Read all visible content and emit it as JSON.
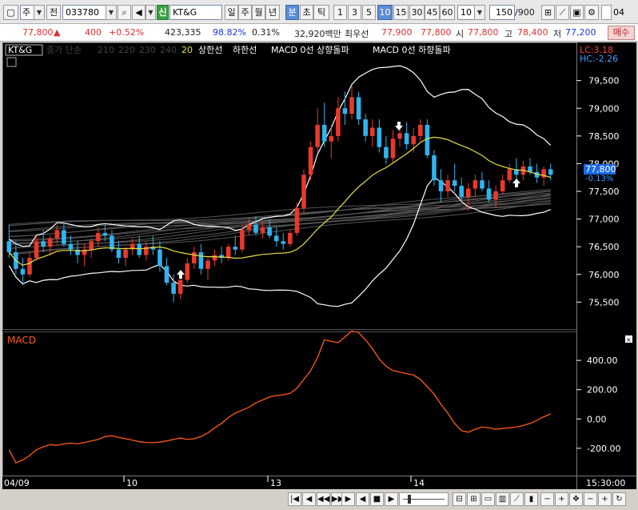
{
  "toolbar": {
    "market": "주",
    "prev_label": "전",
    "code": "033780",
    "badge": "신",
    "name": "KT&G",
    "periods": [
      "일",
      "주",
      "월",
      "년",
      "분",
      "초",
      "틱"
    ],
    "active_period": "분",
    "intervals": [
      "1",
      "3",
      "5",
      "10",
      "15",
      "30",
      "45",
      "60"
    ],
    "active_interval": "10",
    "interval_value": "10",
    "count": "150",
    "count_total": "/900",
    "date_check": "04"
  },
  "quote": {
    "price": "77,800",
    "price_arrow": "▲",
    "change": "400",
    "change_pct": "+0.52%",
    "volume": "423,335",
    "volume_ratio": "98.82%",
    "turnover_ratio": "0.31%",
    "amount": "32,920백만",
    "best_ask_label": "최우선",
    "best_ask": "77,900",
    "best_bid": "77,800",
    "open_label": "시",
    "open": "77,800",
    "high_label": "고",
    "high": "78,400",
    "low_label": "저",
    "low": "77,200",
    "buy_label": "매수"
  },
  "legend": {
    "stock": "KT&G",
    "ma_label": "종가 단순",
    "ma_periods": [
      "210",
      "220",
      "230",
      "240"
    ],
    "ma_20": "20",
    "upper_env": "상한선",
    "lower_env": "하한선",
    "macd_up": "MACD 0선 상향돌파",
    "macd_down": "MACD 0선 하향돌파",
    "lc": "LC:3.18",
    "hc": "HC:-2.26",
    "price_tag": "77,800",
    "pct_tag": "-0.13%"
  },
  "macd_panel": {
    "title": "MACD"
  },
  "x_labels": [
    "04/09",
    "10",
    "13",
    "14",
    "15:30:00"
  ],
  "colors": {
    "up": "#e8392c",
    "down": "#2fb4f0",
    "ma20": "#e8e043",
    "bb": "#ffffff",
    "macd": "#ff5a1a"
  },
  "chart_data": [
    {
      "type": "candlestick",
      "y_ticks": [
        75500,
        76000,
        76500,
        77000,
        77500,
        78000,
        78500,
        79000,
        79500
      ],
      "ylim": [
        75100,
        79900
      ],
      "current_price": 77800,
      "ohlc": [
        [
          76600,
          76900,
          76300,
          76400
        ],
        [
          76400,
          76600,
          76000,
          76100
        ],
        [
          76100,
          76300,
          75800,
          76000
        ],
        [
          76000,
          76400,
          75950,
          76300
        ],
        [
          76300,
          76700,
          76250,
          76600
        ],
        [
          76600,
          76800,
          76400,
          76500
        ],
        [
          76500,
          76700,
          76350,
          76650
        ],
        [
          76650,
          76900,
          76550,
          76800
        ],
        [
          76800,
          76950,
          76500,
          76550
        ],
        [
          76550,
          76700,
          76350,
          76450
        ],
        [
          76450,
          76600,
          76200,
          76350
        ],
        [
          76350,
          76550,
          76150,
          76450
        ],
        [
          76450,
          76650,
          76300,
          76600
        ],
        [
          76600,
          76850,
          76500,
          76750
        ],
        [
          76750,
          76900,
          76600,
          76700
        ],
        [
          76700,
          76800,
          76400,
          76450
        ],
        [
          76450,
          76600,
          76200,
          76300
        ],
        [
          76300,
          76500,
          76150,
          76450
        ],
        [
          76450,
          76650,
          76350,
          76550
        ],
        [
          76550,
          76700,
          76300,
          76350
        ],
        [
          76350,
          76600,
          76250,
          76500
        ],
        [
          76500,
          76700,
          76350,
          76450
        ],
        [
          76450,
          76600,
          76050,
          76150
        ],
        [
          76150,
          76300,
          75800,
          75850
        ],
        [
          75850,
          76000,
          75500,
          75650
        ],
        [
          75650,
          75950,
          75550,
          75900
        ],
        [
          75900,
          76300,
          75850,
          76200
        ],
        [
          76200,
          76500,
          76100,
          76400
        ],
        [
          76400,
          76550,
          76000,
          76100
        ],
        [
          76100,
          76300,
          75900,
          76250
        ],
        [
          76250,
          76450,
          76150,
          76350
        ],
        [
          76350,
          76500,
          76200,
          76300
        ],
        [
          76300,
          76550,
          76250,
          76500
        ],
        [
          76500,
          76700,
          76350,
          76450
        ],
        [
          76450,
          76900,
          76400,
          76800
        ],
        [
          76800,
          77000,
          76700,
          76900
        ],
        [
          76900,
          77050,
          76700,
          76750
        ],
        [
          76750,
          76950,
          76650,
          76850
        ],
        [
          76850,
          77000,
          76650,
          76700
        ],
        [
          76700,
          76850,
          76500,
          76600
        ],
        [
          76600,
          76750,
          76450,
          76550
        ],
        [
          76550,
          76800,
          76500,
          76750
        ],
        [
          76750,
          77300,
          76700,
          77200
        ],
        [
          77200,
          77900,
          77100,
          77800
        ],
        [
          77800,
          78400,
          77700,
          78300
        ],
        [
          78300,
          79000,
          78200,
          78700
        ],
        [
          78700,
          79100,
          78300,
          78400
        ],
        [
          78400,
          78700,
          78100,
          78500
        ],
        [
          78500,
          79200,
          78400,
          79000
        ],
        [
          79000,
          79300,
          78700,
          78900
        ],
        [
          78900,
          79400,
          78800,
          79200
        ],
        [
          79200,
          79300,
          78700,
          78800
        ],
        [
          78800,
          78900,
          78400,
          78500
        ],
        [
          78500,
          78800,
          78300,
          78650
        ],
        [
          78650,
          78800,
          78200,
          78300
        ],
        [
          78300,
          78500,
          78000,
          78100
        ],
        [
          78100,
          78600,
          78000,
          78450
        ],
        [
          78450,
          78700,
          78300,
          78550
        ],
        [
          78550,
          78750,
          78250,
          78350
        ],
        [
          78350,
          78650,
          78200,
          78500
        ],
        [
          78500,
          78800,
          78400,
          78700
        ],
        [
          78700,
          78800,
          78100,
          78150
        ],
        [
          78150,
          78250,
          77600,
          77700
        ],
        [
          77700,
          77900,
          77300,
          77500
        ],
        [
          77500,
          77800,
          77400,
          77700
        ],
        [
          77700,
          78000,
          77500,
          77600
        ],
        [
          77600,
          77750,
          77300,
          77400
        ],
        [
          77400,
          77650,
          77150,
          77550
        ],
        [
          77550,
          77800,
          77400,
          77700
        ],
        [
          77700,
          77850,
          77500,
          77550
        ],
        [
          77550,
          77700,
          77300,
          77350
        ],
        [
          77350,
          77600,
          77200,
          77500
        ],
        [
          77500,
          77800,
          77450,
          77700
        ],
        [
          77700,
          78000,
          77650,
          77900
        ],
        [
          77900,
          78100,
          77700,
          77800
        ],
        [
          77800,
          78050,
          77700,
          77950
        ],
        [
          77950,
          78100,
          77800,
          77850
        ],
        [
          77850,
          78000,
          77650,
          77750
        ],
        [
          77750,
          77950,
          77600,
          77900
        ],
        [
          77900,
          78000,
          77700,
          77800
        ]
      ]
    },
    {
      "type": "line",
      "title": "MACD",
      "y_ticks": [
        -200,
        0,
        200,
        400
      ],
      "ylim": [
        -370,
        570
      ],
      "values": [
        -210,
        -300,
        -280,
        -250,
        -210,
        -190,
        -175,
        -180,
        -170,
        -165,
        -170,
        -160,
        -150,
        -140,
        -120,
        -115,
        -125,
        -135,
        -145,
        -155,
        -160,
        -162,
        -158,
        -150,
        -140,
        -130,
        -140,
        -135,
        -120,
        -95,
        -60,
        -30,
        10,
        40,
        60,
        80,
        110,
        130,
        150,
        160,
        165,
        175,
        210,
        270,
        330,
        420,
        540,
        530,
        520,
        560,
        600,
        590,
        540,
        480,
        410,
        360,
        330,
        320,
        310,
        300,
        270,
        220,
        170,
        100,
        40,
        -30,
        -80,
        -90,
        -70,
        -55,
        -60,
        -70,
        -65,
        -60,
        -55,
        -45,
        -30,
        -10,
        15,
        35
      ]
    }
  ]
}
